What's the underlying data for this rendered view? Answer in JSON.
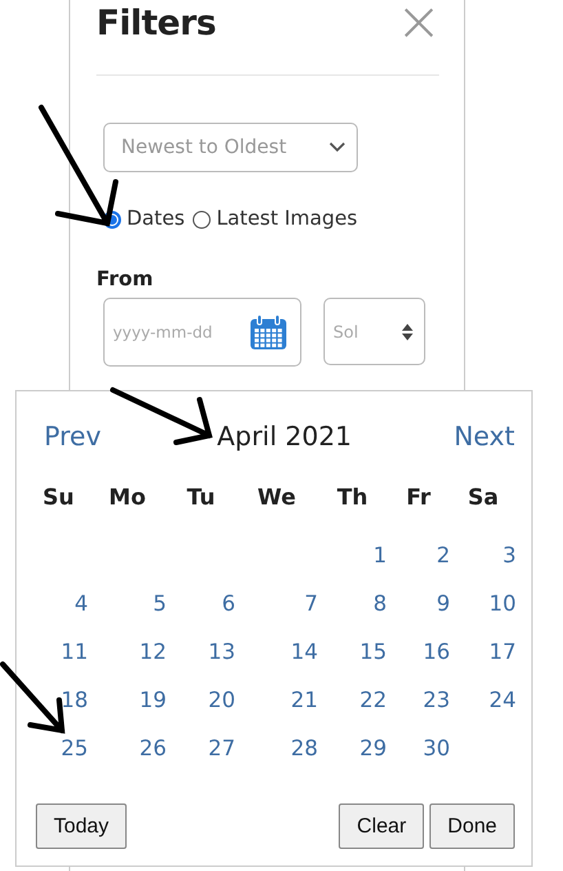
{
  "panel": {
    "title": "Filters",
    "close_label": "×"
  },
  "sort_select": {
    "value": "Newest to Oldest"
  },
  "mode_options": [
    {
      "label": "Dates",
      "selected": true
    },
    {
      "label": "Latest Images",
      "selected": false
    }
  ],
  "from": {
    "label": "From",
    "date_placeholder": "yyyy-mm-dd",
    "sol_placeholder": "Sol"
  },
  "datepicker": {
    "prev": "Prev",
    "month": "April 2021",
    "next": "Next",
    "weekdays": [
      "Su",
      "Mo",
      "Tu",
      "We",
      "Th",
      "Fr",
      "Sa"
    ],
    "weeks": [
      {
        "kind": "leading",
        "days": [
          "1",
          "2",
          "3"
        ]
      },
      {
        "kind": "full",
        "days": [
          "4",
          "5",
          "6",
          "7",
          "8",
          "9",
          "10"
        ]
      },
      {
        "kind": "full",
        "days": [
          "11",
          "12",
          "13",
          "14",
          "15",
          "16",
          "17"
        ]
      },
      {
        "kind": "full",
        "days": [
          "18",
          "19",
          "20",
          "21",
          "22",
          "23",
          "24"
        ]
      },
      {
        "kind": "trailing",
        "days": [
          "25",
          "26",
          "27",
          "28",
          "29",
          "30"
        ]
      }
    ],
    "buttons": [
      {
        "label": "Today",
        "kind": "left"
      },
      {
        "label": "Clear",
        "kind": "right"
      },
      {
        "label": "Done",
        "kind": "right"
      }
    ]
  }
}
